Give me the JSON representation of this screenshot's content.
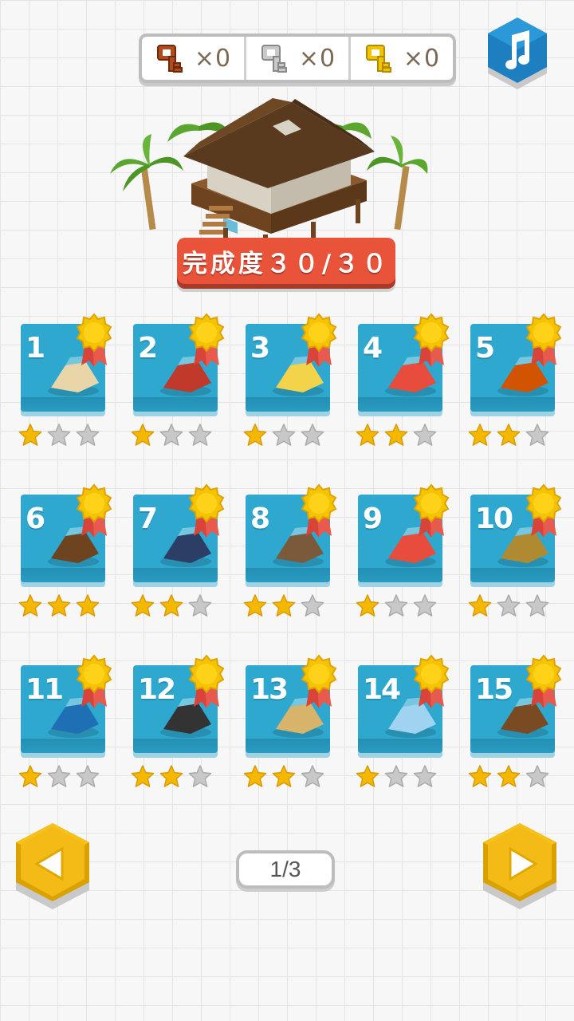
{
  "keys": [
    {
      "name": "bronze-key",
      "count": "×0",
      "color": "#b24a1c"
    },
    {
      "name": "silver-key",
      "count": "×0",
      "color": "#b8b8b8"
    },
    {
      "name": "gold-key",
      "count": "×0",
      "color": "#f2c300"
    }
  ],
  "music_icon": "music-note-icon",
  "progress": {
    "label": "完成度３０/３０",
    "completed": 30,
    "total": 30
  },
  "levels": [
    {
      "number": "1",
      "stars": 1,
      "item": "beach-umbrella"
    },
    {
      "number": "2",
      "stars": 1,
      "item": "hula-dancer"
    },
    {
      "number": "3",
      "stars": 1,
      "item": "rubber-duck"
    },
    {
      "number": "4",
      "stars": 2,
      "item": "parrot-cage"
    },
    {
      "number": "5",
      "stars": 2,
      "item": "boombox"
    },
    {
      "number": "6",
      "stars": 3,
      "item": "pirate-ship"
    },
    {
      "number": "7",
      "stars": 2,
      "item": "suitcase"
    },
    {
      "number": "8",
      "stars": 2,
      "item": "picnic-table"
    },
    {
      "number": "9",
      "stars": 1,
      "item": "crab"
    },
    {
      "number": "10",
      "stars": 1,
      "item": "telescope"
    },
    {
      "number": "11",
      "stars": 1,
      "item": "speedboat"
    },
    {
      "number": "12",
      "stars": 2,
      "item": "bbq-grill"
    },
    {
      "number": "13",
      "stars": 2,
      "item": "sand-castle"
    },
    {
      "number": "14",
      "stars": 1,
      "item": "cocktail-glass"
    },
    {
      "number": "15",
      "stars": 2,
      "item": "rocking-chair"
    }
  ],
  "max_stars": 3,
  "pagination": {
    "label": "1/3"
  },
  "colors": {
    "card": "#2fa8cf",
    "star_on": "#f5b800",
    "star_off": "#c8c8c8",
    "banner": "#e9533a",
    "nav": "#f6c21a"
  }
}
